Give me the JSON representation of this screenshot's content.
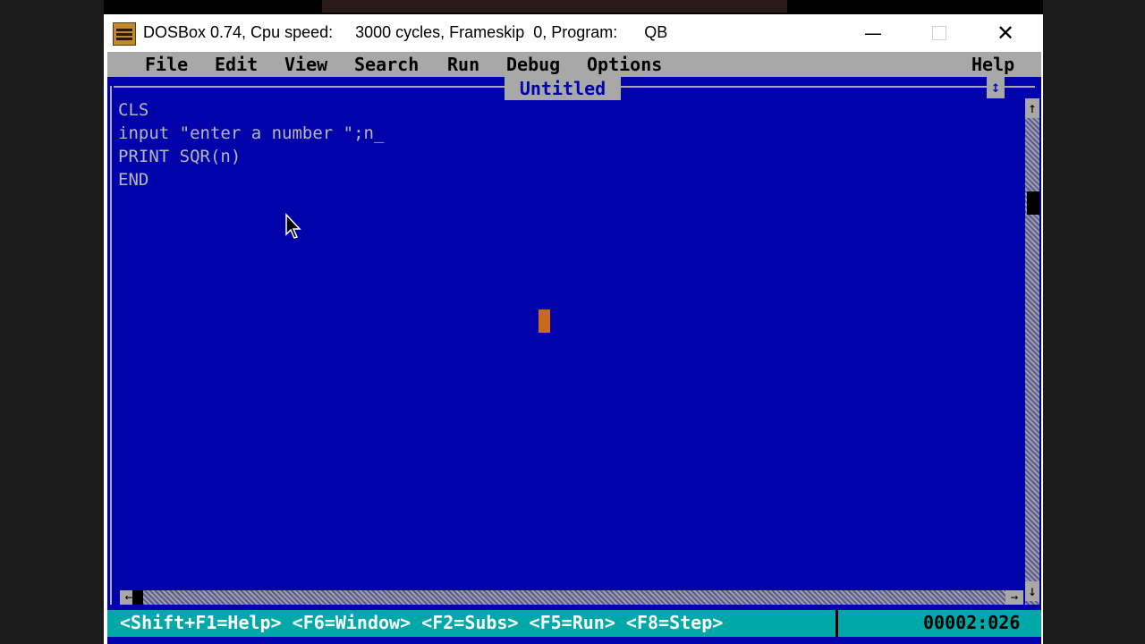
{
  "window": {
    "title": "DOSBox 0.74, Cpu speed:     3000 cycles, Frameskip  0, Program:      QB",
    "controls": {
      "minimize": "—",
      "close": "✕"
    }
  },
  "menu": {
    "file": "File",
    "edit": "Edit",
    "view": "View",
    "search": "Search",
    "run": "Run",
    "debug": "Debug",
    "options": "Options",
    "help": "Help"
  },
  "editor": {
    "document_title": "Untitled",
    "maximize_glyph": "↕",
    "lines": [
      "CLS",
      "input \"enter a number \";n_",
      "PRINT SQR(n)",
      "END"
    ],
    "scroll_up": "↑",
    "scroll_down": "↓",
    "scroll_left": "←",
    "scroll_right": "→"
  },
  "status": {
    "hints": "<Shift+F1=Help> <F6=Window> <F2=Subs> <F5=Run> <F8=Step>",
    "position": "00002:026"
  },
  "colors": {
    "editor_bg": "#0202ab",
    "menubar_bg": "#a8a8a8",
    "statusbar_bg": "#00a8a8",
    "cursor": "#c86a1a"
  }
}
